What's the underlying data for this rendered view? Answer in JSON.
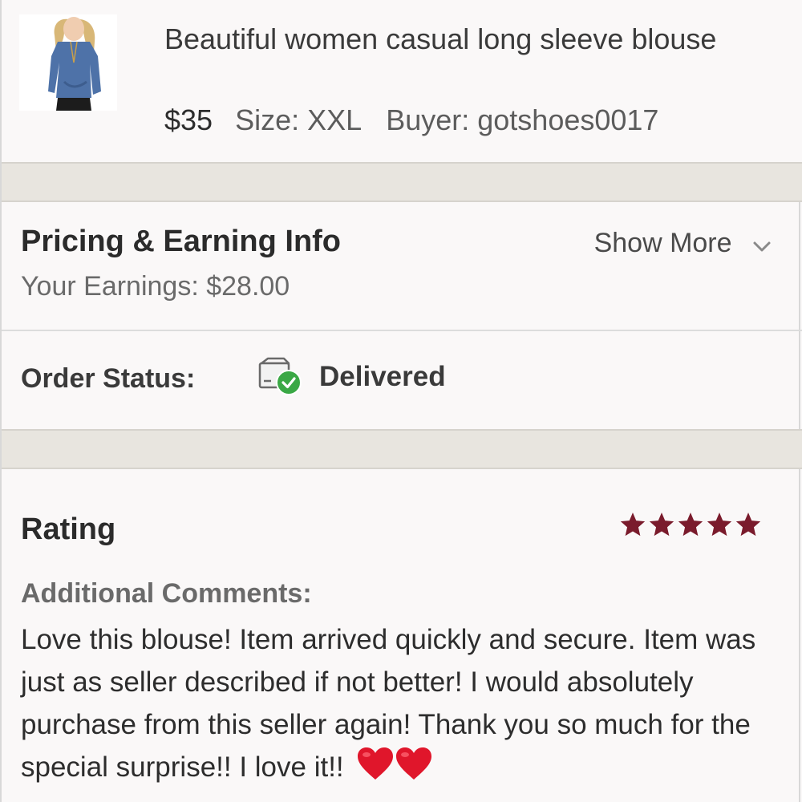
{
  "listing": {
    "title": "Beautiful women casual long sleeve blouse",
    "price": "$35",
    "size": "Size: XXL",
    "buyer": "Buyer: gotshoes0017",
    "thumbnail_icon": "blouse-photo"
  },
  "pricing": {
    "title": "Pricing & Earning Info",
    "show_more": "Show More",
    "earnings": "Your Earnings: $28.00"
  },
  "order": {
    "label": "Order Status:",
    "value": "Delivered",
    "icon": "delivered-box-icon",
    "icon_color": "#3aa845"
  },
  "rating": {
    "title": "Rating",
    "stars": 5,
    "star_color": "#7a1b2c",
    "comments_label": "Additional Comments:",
    "comment": "Love this blouse! Item arrived quickly and secure. Item was just as seller described if not better! I would absolutely purchase from this seller again! Thank you so much for the special surprise!! I love it!!",
    "heart_color": "#e0162b"
  }
}
